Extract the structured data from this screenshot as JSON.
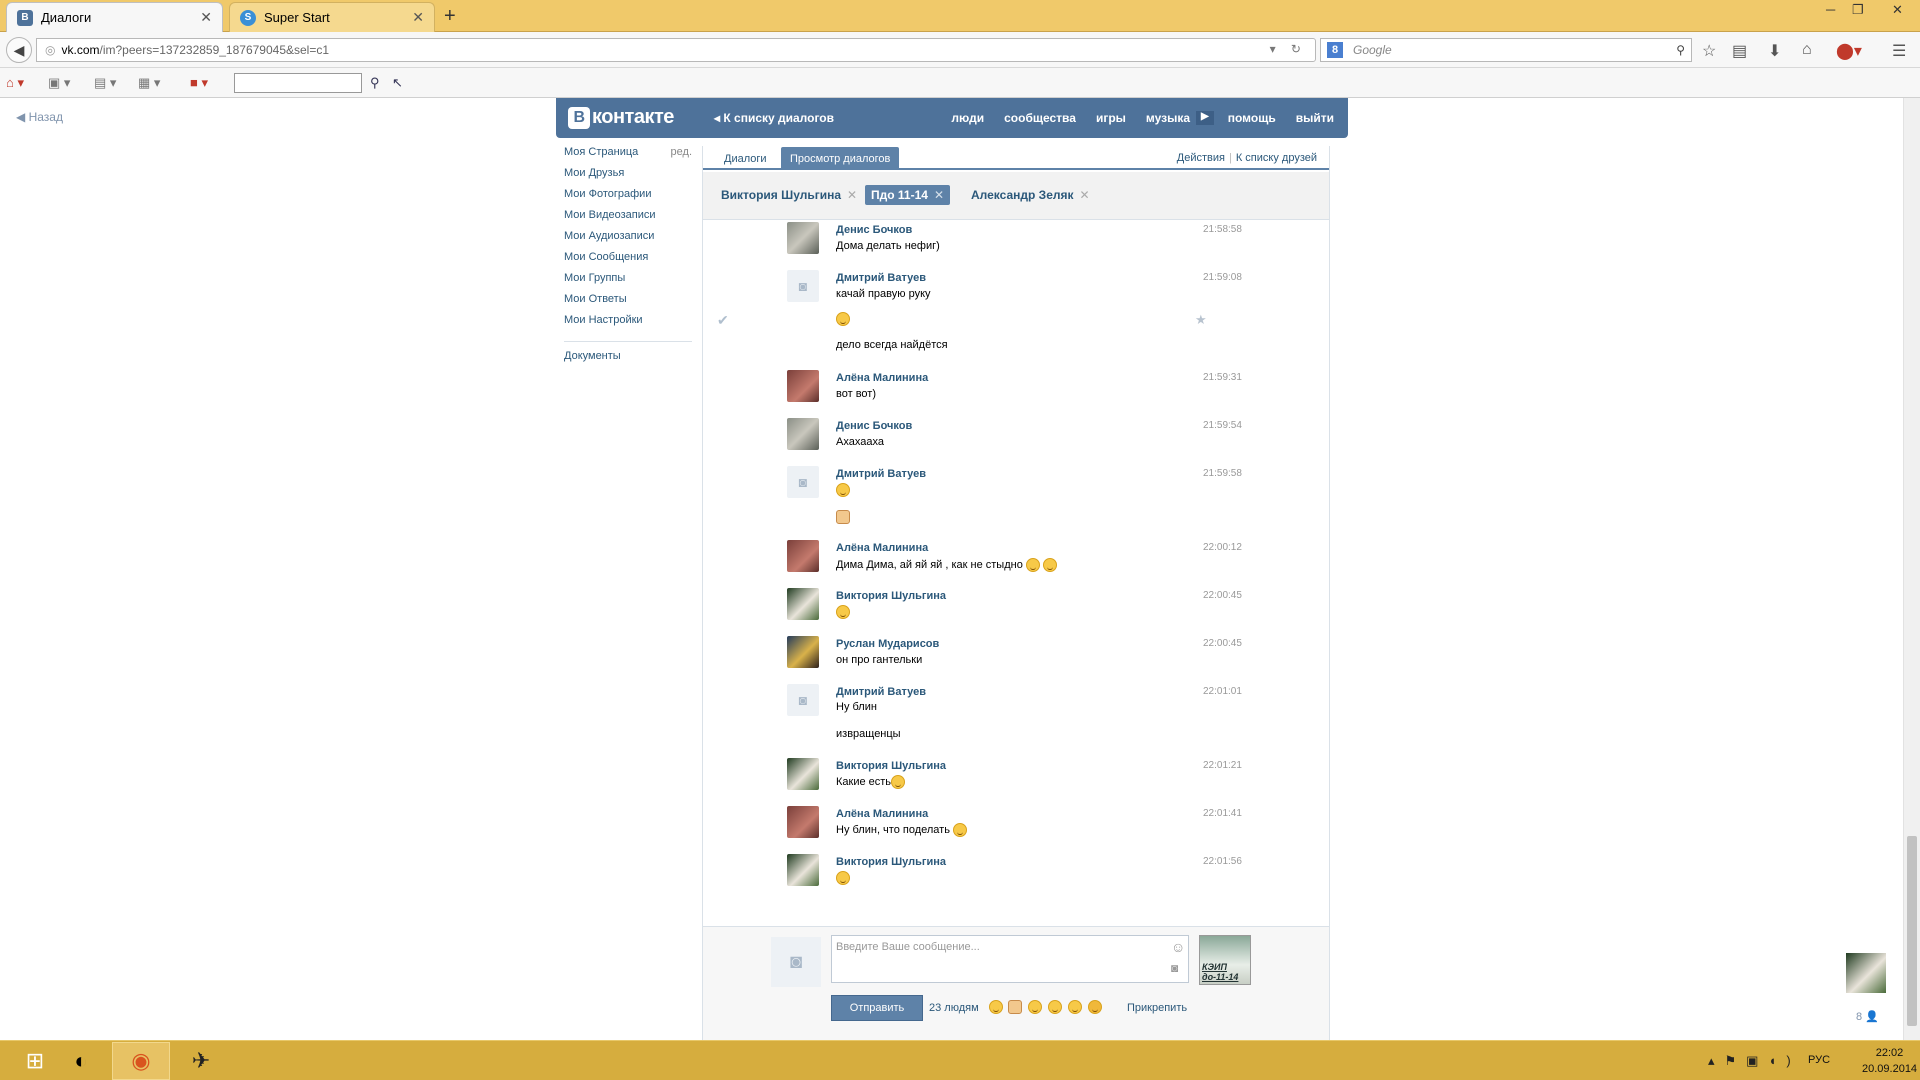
{
  "browser": {
    "tabs": [
      {
        "title": "Диалоги",
        "favicon": "vk-favicon",
        "active": true
      },
      {
        "title": "Super Start",
        "favicon": "superstart-favicon",
        "active": false
      }
    ],
    "url": {
      "host": "vk.com",
      "path": "/im?peers=137232859_187679045&sel=c1"
    },
    "search_placeholder": "Google"
  },
  "page": {
    "back_link": "Назад",
    "header": {
      "logo_text": "контакте",
      "logo_letter": "В",
      "to_dialogs": "К списку диалогов",
      "nav": [
        "люди",
        "сообщества",
        "игры",
        "музыка",
        "помощь",
        "выйти"
      ]
    },
    "menu": {
      "items": [
        "Моя Страница",
        "Мои Друзья",
        "Мои Фотографии",
        "Мои Видеозаписи",
        "Мои Аудиозаписи",
        "Мои Сообщения",
        "Мои Группы",
        "Мои Ответы",
        "Мои Настройки"
      ],
      "edit_label": "ред.",
      "documents": "Документы"
    },
    "content_tabs": {
      "dialogs": "Диалоги",
      "view_dialogs": "Просмотр диалогов",
      "actions": "Действия",
      "to_friends": "К списку друзей"
    },
    "peers": [
      {
        "name": "Виктория Шульгина",
        "active": false
      },
      {
        "name": "Пдо 11-14",
        "active": true
      },
      {
        "name": "Александр Зеляк",
        "active": false
      }
    ],
    "messages": [
      {
        "author": "Денис Бочков",
        "time": "21:58:58",
        "lines": [
          "Дома делать нефиг)"
        ]
      },
      {
        "author": "Дмитрий Ватуев",
        "time": "21:59:08",
        "lines": [
          "качай правую руку",
          "",
          "дело всегда найдётся"
        ]
      },
      {
        "author": "Алёна Малинина",
        "time": "21:59:31",
        "lines": [
          "вот вот)"
        ]
      },
      {
        "author": "Денис Бочков",
        "time": "21:59:54",
        "lines": [
          "Ахахааха"
        ]
      },
      {
        "author": "Дмитрий Ватуев",
        "time": "21:59:58",
        "lines": [
          "",
          ""
        ]
      },
      {
        "author": "Алёна Малинина",
        "time": "22:00:12",
        "lines": [
          "Дима Дима, ай яй яй , как не стыдно"
        ]
      },
      {
        "author": "Виктория Шульгина",
        "time": "22:00:45",
        "lines": [
          ""
        ]
      },
      {
        "author": "Руслан Мударисов",
        "time": "22:00:45",
        "lines": [
          "он про гантельки"
        ]
      },
      {
        "author": "Дмитрий Ватуев",
        "time": "22:01:01",
        "lines": [
          "Ну блин",
          "извращенцы"
        ]
      },
      {
        "author": "Виктория Шульгина",
        "time": "22:01:21",
        "lines": [
          "Какие есть"
        ]
      },
      {
        "author": "Алёна Малинина",
        "time": "22:01:41",
        "lines": [
          "Ну блин, что поделать"
        ]
      },
      {
        "author": "Виктория Шульгина",
        "time": "22:01:56",
        "lines": [
          ""
        ]
      }
    ],
    "composer": {
      "placeholder": "Введите Ваше сообщение...",
      "send": "Отправить",
      "people_count": "23 людям",
      "attach": "Прикрепить",
      "chat_thumb_text": "КЭИП до-11-14"
    },
    "side_count": "8"
  },
  "taskbar": {
    "lang": "РУС",
    "time": "22:02",
    "date": "20.09.2014"
  },
  "colors": {
    "vk_blue": "#4e729a",
    "link": "#2b587a",
    "taskbar": "#d6ad3e",
    "tabbar": "#f0c96a"
  }
}
